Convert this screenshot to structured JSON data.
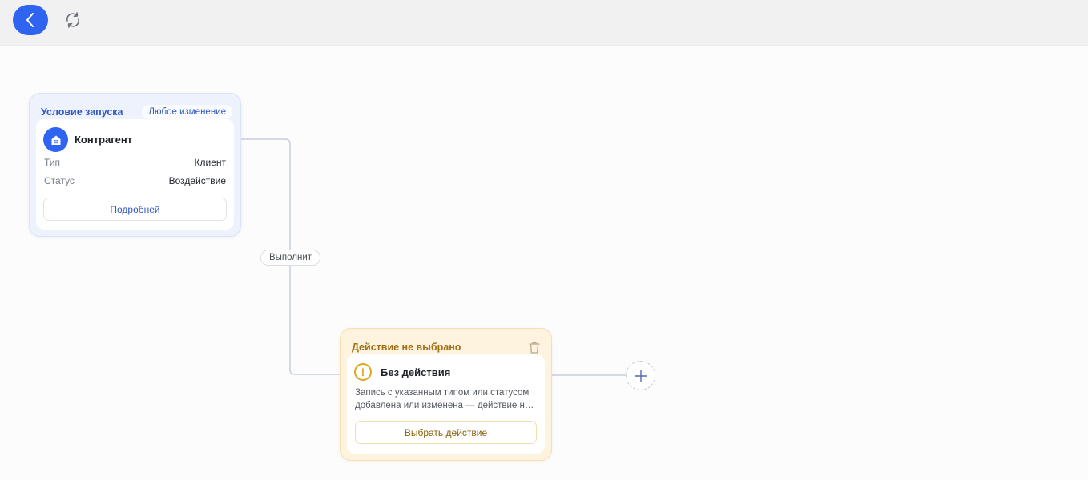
{
  "toolbar": {
    "back_icon": "chevron-left-icon",
    "refresh_icon": "refresh-icon",
    "accent_color": "#2f64f0"
  },
  "trigger_node": {
    "title": "Условие запуска",
    "badge": "Любое изменение",
    "entity_icon": "building-icon",
    "entity": "Контрагент",
    "fields": [
      {
        "key": "Тип",
        "value": "Клиент"
      },
      {
        "key": "Статус",
        "value": "Воздействие"
      }
    ],
    "details_button": "Подробней",
    "color": "#3158c5"
  },
  "edge": {
    "label": "Выполнит"
  },
  "action_node": {
    "title": "Действие не выбрано",
    "delete_icon": "trash-icon",
    "warning_icon": "exclamation-circle-icon",
    "action_name": "Без действия",
    "description": "Запись с указанным типом или статусом добавлена или изменена — действие не выбрано",
    "choose_button": "Выбрать действие",
    "color": "#a07012"
  },
  "add_node": {
    "icon": "plus-icon"
  }
}
